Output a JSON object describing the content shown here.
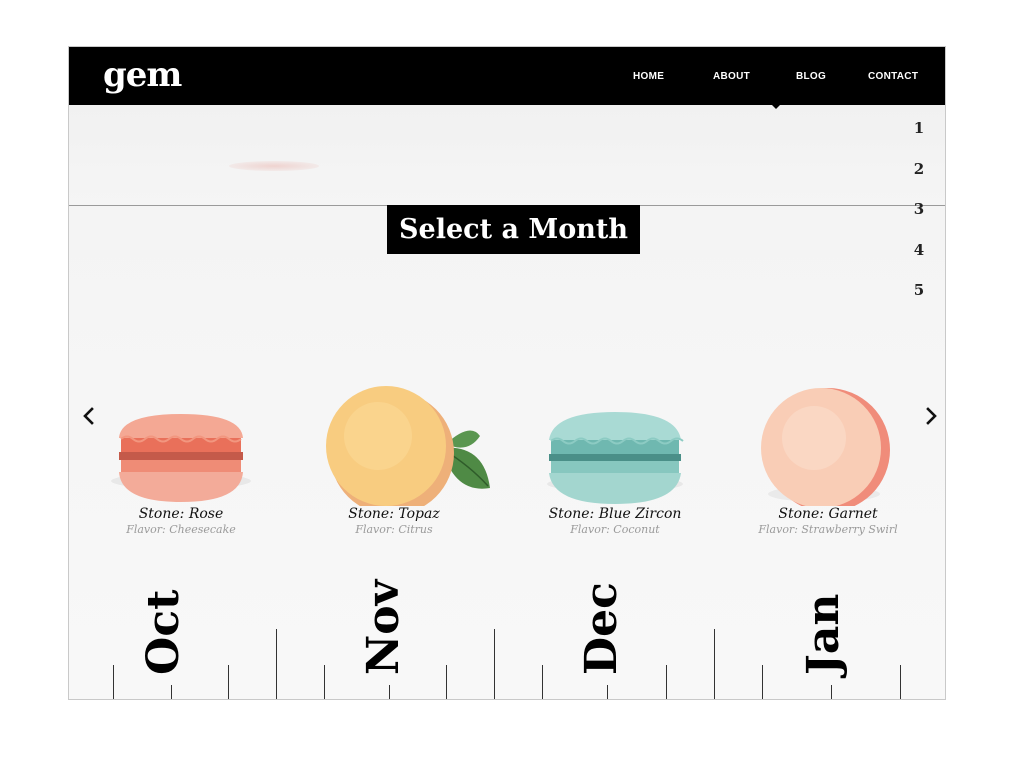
{
  "header": {
    "logo": "gem",
    "nav": [
      "HOME",
      "ABOUT",
      "BLOG",
      "CONTACT"
    ]
  },
  "pagination": [
    "1",
    "2",
    "3",
    "4",
    "5"
  ],
  "title": "Select a Month",
  "carousel": {
    "items": [
      {
        "stone": "Stone: Rose",
        "flavor": "Flavor: Cheesecake",
        "color": "#f2a08c"
      },
      {
        "stone": "Stone: Topaz",
        "flavor": "Flavor: Citrus",
        "color": "#f8cd7a"
      },
      {
        "stone": "Stone: Blue Zircon",
        "flavor": "Flavor: Coconut",
        "color": "#a6d7d1"
      },
      {
        "stone": "Stone: Garnet",
        "flavor": "Flavor: Strawberry Swirl",
        "color": "#f7c4ad"
      }
    ]
  },
  "months": [
    "Oct",
    "Nov",
    "Dec",
    "Jan"
  ],
  "icons": {
    "prev": "chevron-left-icon",
    "next": "chevron-right-icon"
  }
}
